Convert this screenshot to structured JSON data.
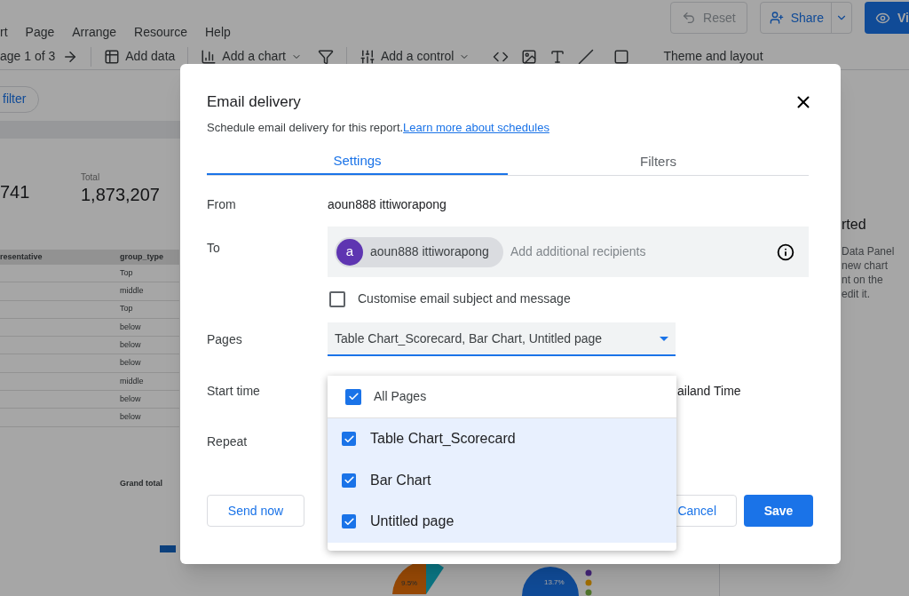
{
  "app": {
    "menu": [
      "rt",
      "Page",
      "Arrange",
      "Resource",
      "Help"
    ],
    "toolbar": {
      "page_indicator": "age 1 of 3",
      "add_data": "Add data",
      "add_chart": "Add a chart",
      "add_control": "Add a control",
      "theme": "Theme and layout"
    },
    "header_buttons": {
      "reset": "Reset",
      "share": "Share",
      "view": "Vi"
    },
    "filter_chip": "filter"
  },
  "canvas": {
    "scorecards": [
      {
        "value": "741"
      },
      {
        "label": "Total",
        "value": "1,873,207"
      }
    ],
    "table": {
      "columns": [
        "resentative",
        "group_type"
      ],
      "rows": [
        {
          "group_type": "Top"
        },
        {
          "group_type": "middle"
        },
        {
          "group_type": "Top"
        },
        {
          "group_type": "below"
        },
        {
          "group_type": "below"
        },
        {
          "group_type": "below"
        },
        {
          "group_type": "middle"
        },
        {
          "group_type": "below"
        },
        {
          "group_type": "below"
        }
      ],
      "grand_total": "Grand total"
    },
    "pie_labels": [
      "9.5%",
      "13.7%"
    ]
  },
  "side_panel": {
    "heading": "rted",
    "lines": [
      "Data Panel",
      "new chart",
      "nt on the",
      "edit it."
    ]
  },
  "dialog": {
    "title": "Email delivery",
    "subtitle": "Schedule email delivery for this report.",
    "link": "Learn more about schedules",
    "tabs": [
      {
        "label": "Settings",
        "selected": true
      },
      {
        "label": "Filters",
        "selected": false
      }
    ],
    "from": {
      "label": "From",
      "value": "aoun888 ittiworapong"
    },
    "to": {
      "label": "To",
      "recipients": [
        {
          "initial": "a",
          "name": "aoun888 ittiworapong"
        }
      ],
      "placeholder": "Add additional recipients"
    },
    "customise": {
      "label": "Customise email subject and message",
      "checked": false
    },
    "pages": {
      "label": "Pages",
      "value": "Table Chart_Scorecard, Bar Chart, Untitled page",
      "expanded": true,
      "options": [
        {
          "kind": "all",
          "label": "All Pages",
          "checked": true,
          "selected": false
        },
        {
          "kind": "page",
          "label": "Table Chart_Scorecard",
          "checked": true,
          "selected": true
        },
        {
          "kind": "page",
          "label": "Bar Chart",
          "checked": true,
          "selected": true
        },
        {
          "kind": "page",
          "label": "Untitled page",
          "checked": true,
          "selected": true
        }
      ]
    },
    "start_time": {
      "label": "Start time",
      "value": "ailand Time"
    },
    "repeat": {
      "label": "Repeat"
    },
    "buttons": {
      "send_now": "Send now",
      "cancel": "Cancel",
      "save": "Save"
    }
  }
}
